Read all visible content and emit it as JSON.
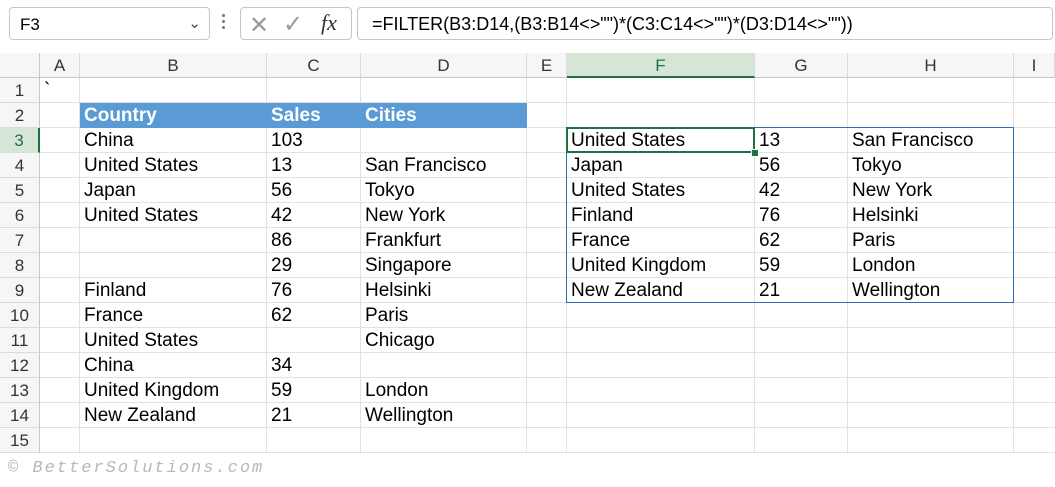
{
  "formula_bar": {
    "name_box": "F3",
    "cancel_icon": "✕",
    "enter_icon": "✓",
    "fx_icon": "fx",
    "formula": "=FILTER(B3:D14,(B3:B14<>\"\")*(C3:C14<>\"\")*(D3:D14<>\"\"))"
  },
  "columns": [
    "A",
    "B",
    "C",
    "D",
    "E",
    "F",
    "G",
    "H",
    "I"
  ],
  "selected_column": "F",
  "rows": [
    "1",
    "2",
    "3",
    "4",
    "5",
    "6",
    "7",
    "8",
    "9",
    "10",
    "11",
    "12",
    "13",
    "14",
    "15"
  ],
  "selected_row": "3",
  "cell_A1": "`",
  "table_header": {
    "country": "Country",
    "sales": "Sales",
    "cities": "Cities"
  },
  "source_rows": [
    {
      "country": "China",
      "sales": "103",
      "city": ""
    },
    {
      "country": "United States",
      "sales": "13",
      "city": "San Francisco"
    },
    {
      "country": "Japan",
      "sales": "56",
      "city": "Tokyo"
    },
    {
      "country": "United States",
      "sales": "42",
      "city": "New York"
    },
    {
      "country": "",
      "sales": "86",
      "city": "Frankfurt"
    },
    {
      "country": "",
      "sales": "29",
      "city": "Singapore"
    },
    {
      "country": "Finland",
      "sales": "76",
      "city": "Helsinki"
    },
    {
      "country": "France",
      "sales": "62",
      "city": "Paris"
    },
    {
      "country": "United States",
      "sales": "",
      "city": "Chicago"
    },
    {
      "country": "China",
      "sales": "34",
      "city": ""
    },
    {
      "country": "United Kingdom",
      "sales": "59",
      "city": "London"
    },
    {
      "country": "New Zealand",
      "sales": "21",
      "city": "Wellington"
    }
  ],
  "result_rows": [
    {
      "country": "United States",
      "sales": "13",
      "city": "San Francisco"
    },
    {
      "country": "Japan",
      "sales": "56",
      "city": "Tokyo"
    },
    {
      "country": "United States",
      "sales": "42",
      "city": "New York"
    },
    {
      "country": "Finland",
      "sales": "76",
      "city": "Helsinki"
    },
    {
      "country": "France",
      "sales": "62",
      "city": "Paris"
    },
    {
      "country": "United Kingdom",
      "sales": "59",
      "city": "London"
    },
    {
      "country": "New Zealand",
      "sales": "21",
      "city": "Wellington"
    }
  ],
  "footer": "© BetterSolutions.com",
  "colors": {
    "header_fill": "#5b9bd5",
    "selection": "#1e7145",
    "spill_border": "#2f6fb5"
  }
}
